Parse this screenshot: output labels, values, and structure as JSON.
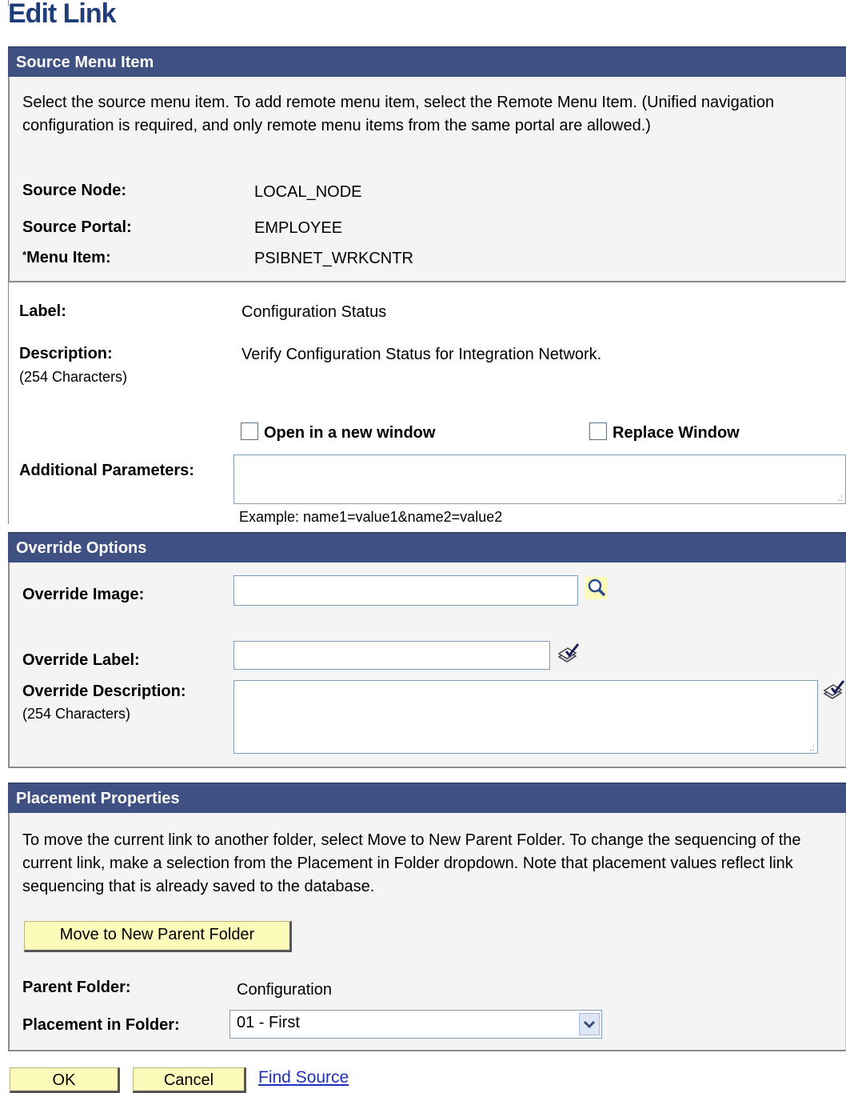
{
  "title": "Edit Link",
  "source_menu_item": {
    "heading": "Source Menu Item",
    "instructions": "Select the source menu item. To add remote menu item, select the Remote Menu Item. (Unified navigation configuration is required, and only remote menu items from the same portal are allowed.)",
    "source_node_label": "Source Node:",
    "source_node_value": "LOCAL_NODE",
    "source_portal_label": "Source Portal:",
    "source_portal_value": "EMPLOYEE",
    "menu_item_required": "*",
    "menu_item_label": "Menu Item:",
    "menu_item_value": "PSIBNET_WRKCNTR"
  },
  "link_details": {
    "label_label": "Label:",
    "label_value": "Configuration Status",
    "description_label": "Description:",
    "description_hint": "(254 Characters)",
    "description_value": "Verify Configuration Status for Integration Network.",
    "open_new_window_label": "Open in a new window",
    "open_new_window_checked": false,
    "replace_window_label": "Replace Window",
    "replace_window_checked": false,
    "additional_params_label": "Additional Parameters:",
    "additional_params_value": "",
    "additional_params_example": "Example: name1=value1&name2=value2"
  },
  "override_options": {
    "heading": "Override Options",
    "image_label": "Override Image:",
    "image_value": "",
    "label_label": "Override Label:",
    "label_value": "",
    "description_label": "Override Description:",
    "description_hint": "(254 Characters)",
    "description_value": ""
  },
  "placement": {
    "heading": "Placement Properties",
    "instructions": "To move the current link to another folder, select Move to New Parent Folder. To change the sequencing of the current link, make a selection from the Placement in Folder dropdown. Note that placement values reflect link sequencing that is already saved to the database.",
    "move_button": "Move to New Parent Folder",
    "parent_folder_label": "Parent Folder:",
    "parent_folder_value": "Configuration",
    "placement_label": "Placement in Folder:",
    "placement_value": "01 - First"
  },
  "footer": {
    "ok": "OK",
    "cancel": "Cancel",
    "find_source": "Find Source"
  },
  "colors": {
    "section_bar": "#3f5182",
    "title": "#1f3d7a",
    "button_bg": "#fdfbb9",
    "link": "#1f2fbf"
  },
  "icons": [
    "lookup-icon",
    "spell-check-icon",
    "dropdown-arrow-icon"
  ]
}
